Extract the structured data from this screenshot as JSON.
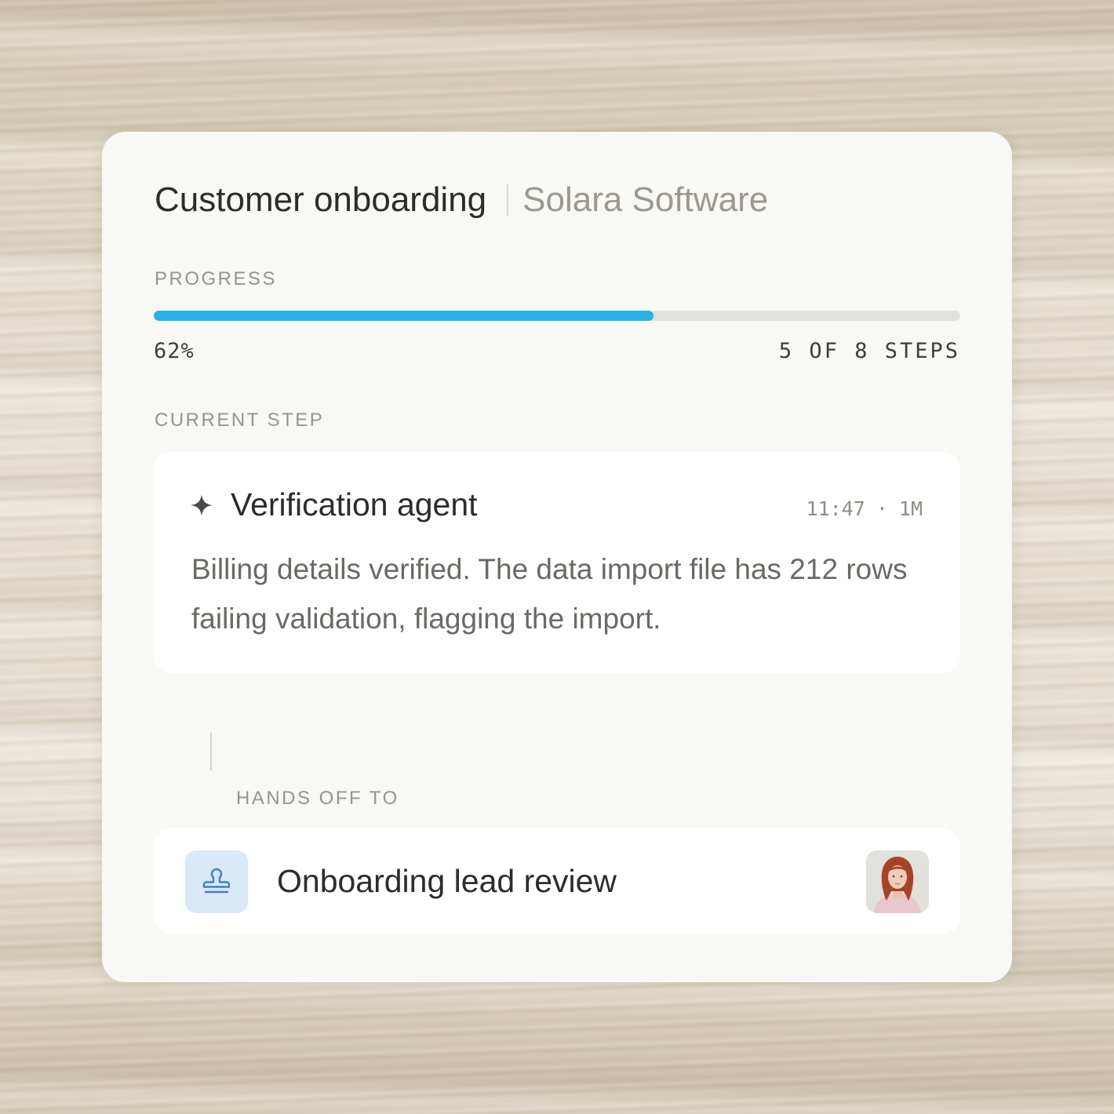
{
  "header": {
    "title": "Customer onboarding",
    "company": "Solara Software"
  },
  "progress": {
    "label": "PROGRESS",
    "percent_text": "62%",
    "fill_fraction": 0.62,
    "steps_text": "5 OF 8 STEPS"
  },
  "current_step": {
    "label": "CURRENT STEP",
    "icon": "sparkle-icon",
    "agent": "Verification agent",
    "time": "11:47",
    "duration": "1M",
    "message": "Billing details verified. The data import file has 212 rows failing validation, flagging the import."
  },
  "handoff": {
    "label": "HANDS OFF TO",
    "icon": "stamp-icon",
    "title": "Onboarding lead review",
    "avatar": "person-avatar"
  },
  "colors": {
    "accent": "#29b1e6",
    "stamp_bg": "#d9e9f8",
    "stamp_icon": "#3f7fd0"
  }
}
